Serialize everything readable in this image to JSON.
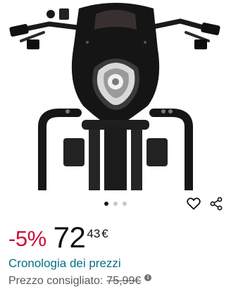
{
  "product_image": {
    "alt": "Product image",
    "dots": [
      {
        "active": true
      },
      {
        "active": false
      },
      {
        "active": false
      }
    ]
  },
  "icons": {
    "wishlist": "heart-outline-icon",
    "share": "share-icon"
  },
  "price": {
    "discount": "-5%",
    "whole": "72",
    "fraction": "43",
    "currency": "€"
  },
  "history_link": "Cronologia dei prezzi",
  "list_price": {
    "label": "Prezzo consigliato:",
    "value": "75,99€"
  },
  "colors": {
    "discount": "#cc0c39",
    "link": "#007185",
    "muted_text": "#565959"
  }
}
